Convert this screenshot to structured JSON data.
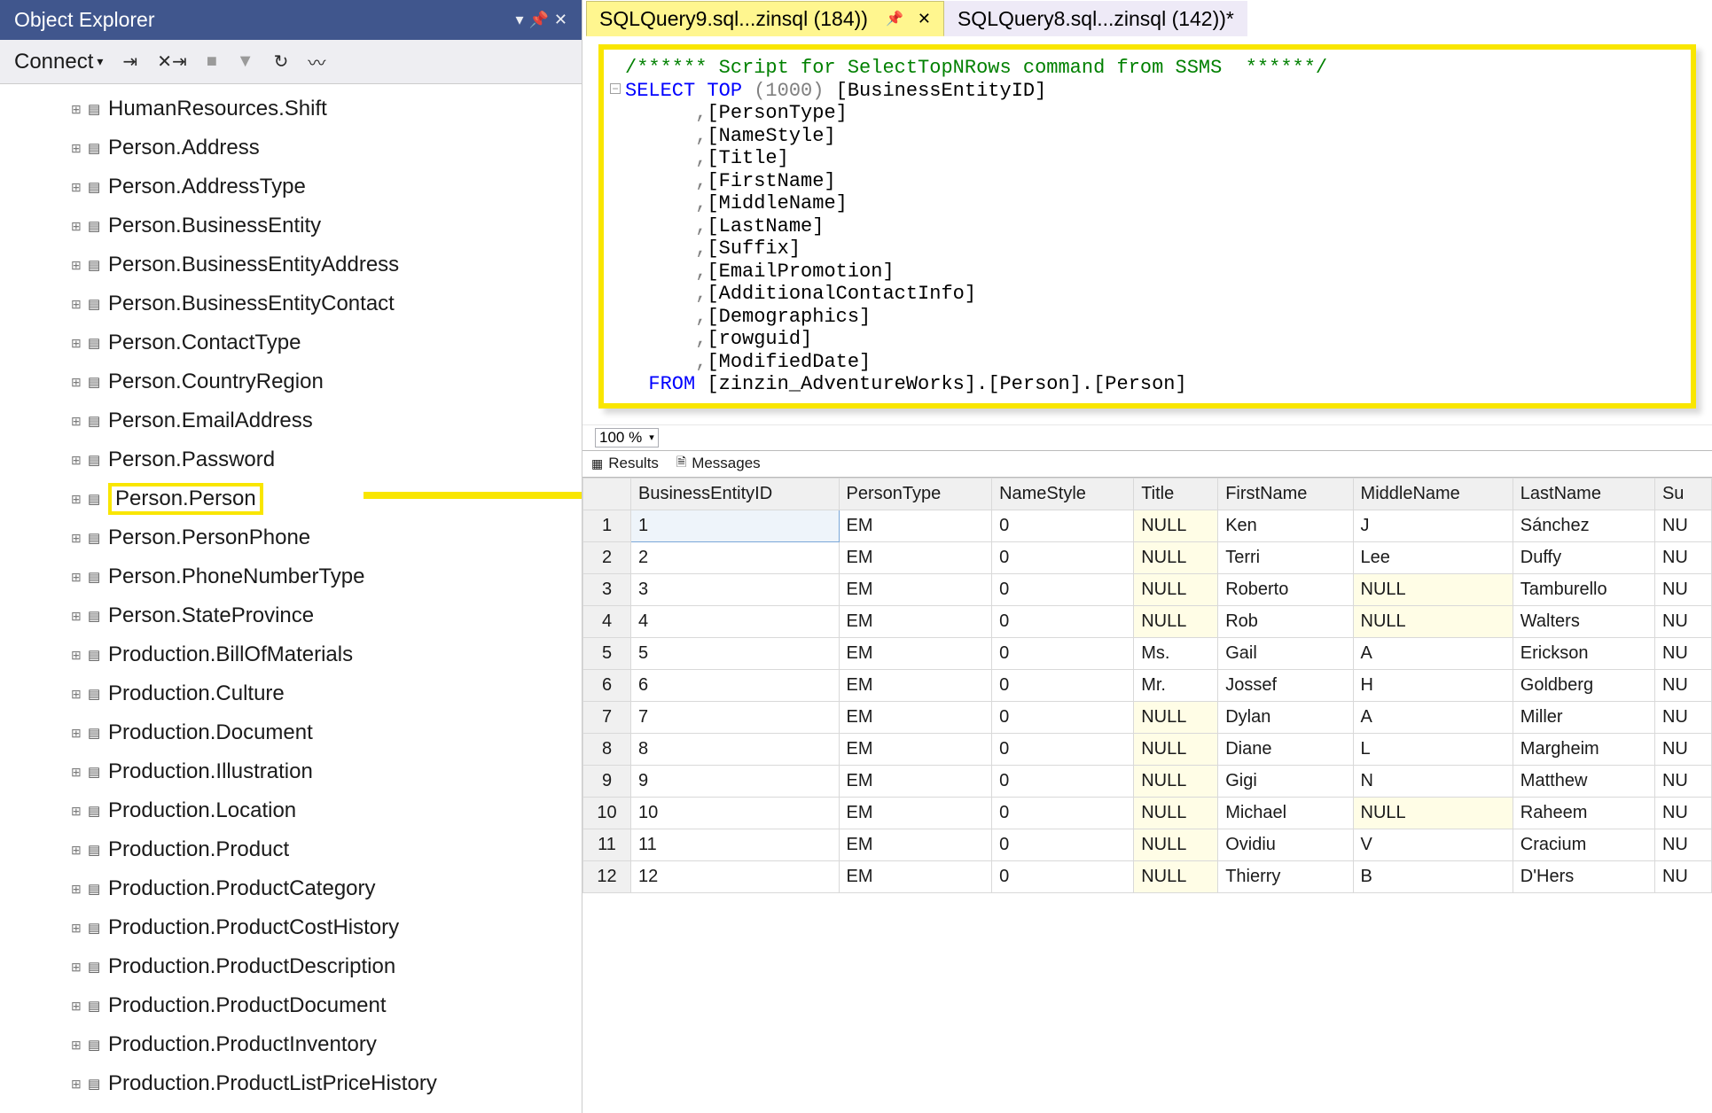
{
  "objExplorer": {
    "title": "Object Explorer",
    "toolbar": {
      "connect": "Connect"
    },
    "items": [
      "HumanResources.Shift",
      "Person.Address",
      "Person.AddressType",
      "Person.BusinessEntity",
      "Person.BusinessEntityAddress",
      "Person.BusinessEntityContact",
      "Person.ContactType",
      "Person.CountryRegion",
      "Person.EmailAddress",
      "Person.Password",
      "Person.Person",
      "Person.PersonPhone",
      "Person.PhoneNumberType",
      "Person.StateProvince",
      "Production.BillOfMaterials",
      "Production.Culture",
      "Production.Document",
      "Production.Illustration",
      "Production.Location",
      "Production.Product",
      "Production.ProductCategory",
      "Production.ProductCostHistory",
      "Production.ProductDescription",
      "Production.ProductDocument",
      "Production.ProductInventory",
      "Production.ProductListPriceHistory"
    ],
    "highlightIndex": 10
  },
  "tabs": {
    "active": "SQLQuery9.sql...zinsql (184))",
    "inactive": "SQLQuery8.sql...zinsql (142))*"
  },
  "sql": {
    "comment": "/****** Script for SelectTopNRows command from SSMS  ******/",
    "selectKw": "SELECT",
    "topKw": "TOP",
    "topNum": "(1000)",
    "firstCol": " [BusinessEntityID]",
    "cols": [
      ",[PersonType]",
      ",[NameStyle]",
      ",[Title]",
      ",[FirstName]",
      ",[MiddleName]",
      ",[LastName]",
      ",[Suffix]",
      ",[EmailPromotion]",
      ",[AdditionalContactInfo]",
      ",[Demographics]",
      ",[rowguid]",
      ",[ModifiedDate]"
    ],
    "fromKw": "FROM",
    "fromTable": " [zinzin_AdventureWorks].[Person].[Person]"
  },
  "zoom": {
    "value": "100 %"
  },
  "resultTabs": {
    "results": "Results",
    "messages": "Messages"
  },
  "grid": {
    "headers": [
      "BusinessEntityID",
      "PersonType",
      "NameStyle",
      "Title",
      "FirstName",
      "MiddleName",
      "LastName",
      "Su"
    ],
    "rows": [
      {
        "n": "1",
        "cells": [
          "1",
          "EM",
          "0",
          "NULL",
          "Ken",
          "J",
          "Sánchez",
          "NU"
        ]
      },
      {
        "n": "2",
        "cells": [
          "2",
          "EM",
          "0",
          "NULL",
          "Terri",
          "Lee",
          "Duffy",
          "NU"
        ]
      },
      {
        "n": "3",
        "cells": [
          "3",
          "EM",
          "0",
          "NULL",
          "Roberto",
          "NULL",
          "Tamburello",
          "NU"
        ]
      },
      {
        "n": "4",
        "cells": [
          "4",
          "EM",
          "0",
          "NULL",
          "Rob",
          "NULL",
          "Walters",
          "NU"
        ]
      },
      {
        "n": "5",
        "cells": [
          "5",
          "EM",
          "0",
          "Ms.",
          "Gail",
          "A",
          "Erickson",
          "NU"
        ]
      },
      {
        "n": "6",
        "cells": [
          "6",
          "EM",
          "0",
          "Mr.",
          "Jossef",
          "H",
          "Goldberg",
          "NU"
        ]
      },
      {
        "n": "7",
        "cells": [
          "7",
          "EM",
          "0",
          "NULL",
          "Dylan",
          "A",
          "Miller",
          "NU"
        ]
      },
      {
        "n": "8",
        "cells": [
          "8",
          "EM",
          "0",
          "NULL",
          "Diane",
          "L",
          "Margheim",
          "NU"
        ]
      },
      {
        "n": "9",
        "cells": [
          "9",
          "EM",
          "0",
          "NULL",
          "Gigi",
          "N",
          "Matthew",
          "NU"
        ]
      },
      {
        "n": "10",
        "cells": [
          "10",
          "EM",
          "0",
          "NULL",
          "Michael",
          "NULL",
          "Raheem",
          "NU"
        ]
      },
      {
        "n": "11",
        "cells": [
          "11",
          "EM",
          "0",
          "NULL",
          "Ovidiu",
          "V",
          "Cracium",
          "NU"
        ]
      },
      {
        "n": "12",
        "cells": [
          "12",
          "EM",
          "0",
          "NULL",
          "Thierry",
          "B",
          "D'Hers",
          "NU"
        ]
      }
    ]
  }
}
